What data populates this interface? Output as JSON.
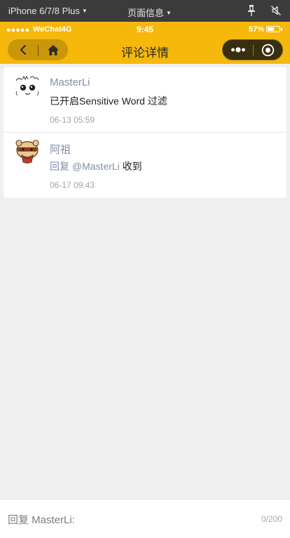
{
  "devtools": {
    "device_label": "iPhone 6/7/8 Plus",
    "page_info_label": "页面信息",
    "icons": {
      "pin": "pin-icon",
      "mute": "mute-icon",
      "caret": "caret-down-icon"
    }
  },
  "status_bar": {
    "signal": "●●●●●",
    "carrier": "WeChat4G",
    "time": "9:45",
    "battery_percent": "57%",
    "battery_level": 0.57
  },
  "nav": {
    "title": "评论详情",
    "icons": {
      "back": "back-chevron-icon",
      "home": "home-icon",
      "more": "more-dots-icon",
      "target": "target-icon"
    }
  },
  "comments": [
    {
      "author": "MasterLi",
      "content": "已开启Sensitive Word 过滤",
      "time": "06-13 05:59",
      "avatar": "cartoon-face-avatar"
    },
    {
      "author": "阿祖",
      "reply_prefix": "回复",
      "mention": "@MasterLi",
      "content": "收到",
      "time": "06-17 09:43",
      "avatar": "cartoon-bear-avatar"
    }
  ],
  "reply": {
    "placeholder": "回复 MasterLi:",
    "char_count": "0/200"
  },
  "colors": {
    "accent": "#f5b80b",
    "accent_dark": "#c99708",
    "link": "#7f8fa6",
    "background": "#efefef"
  }
}
